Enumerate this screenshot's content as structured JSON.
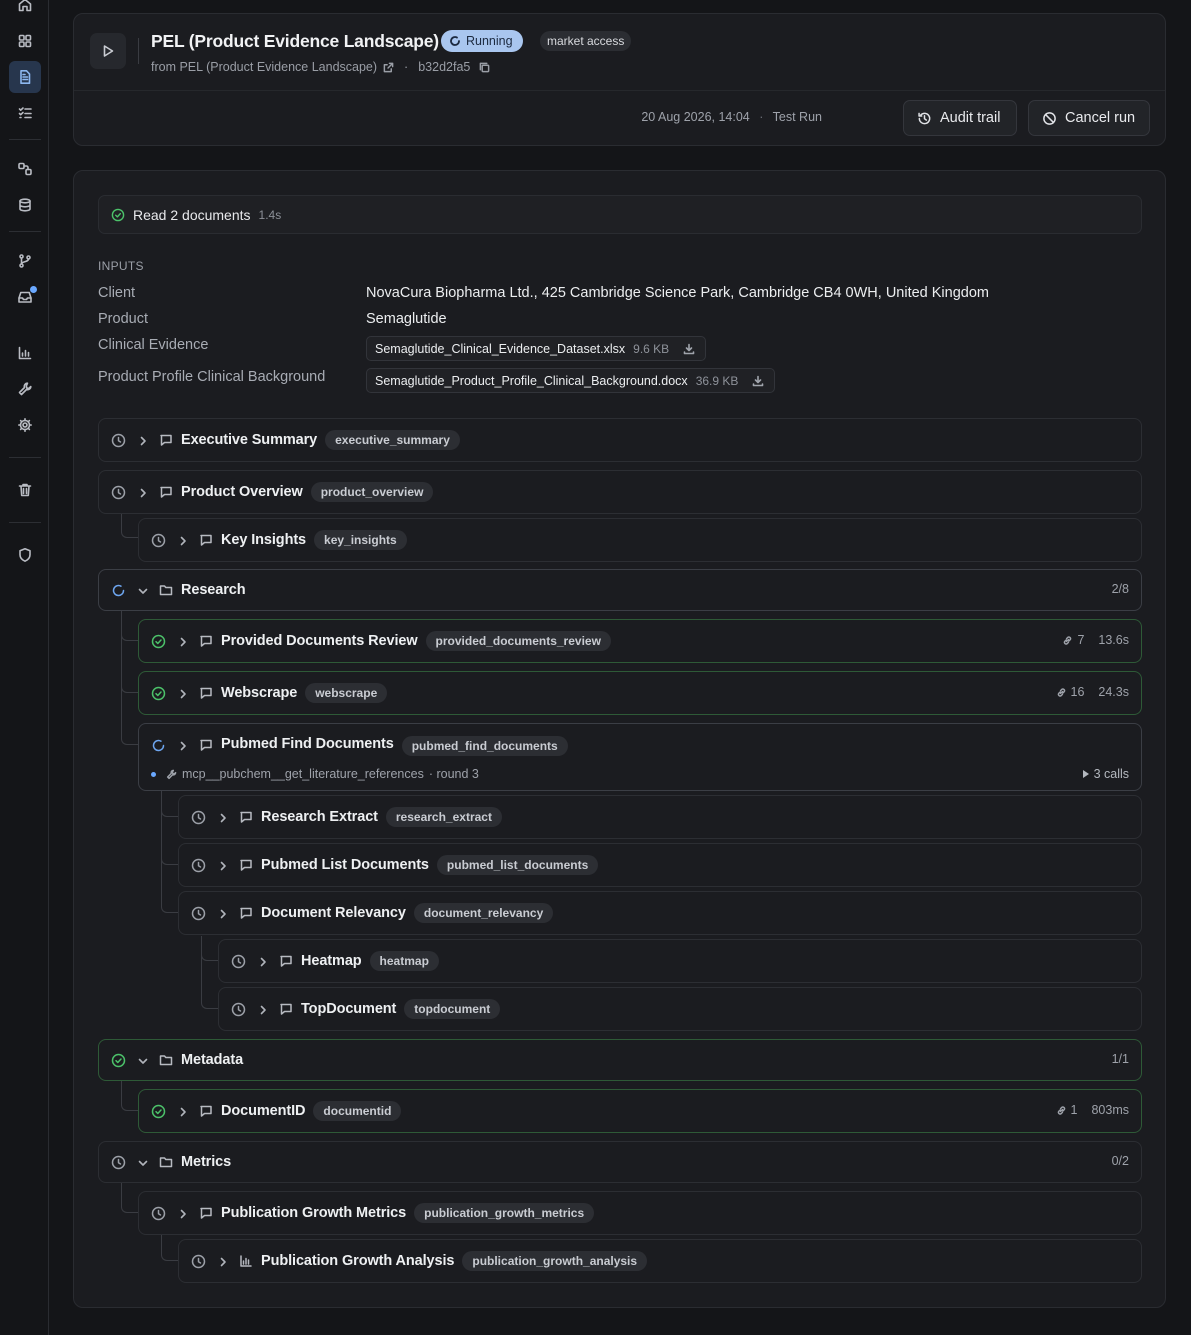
{
  "sidebar": {
    "items": [
      "home-icon",
      "dashboard-icon",
      "runs-icon",
      "tasks-icon",
      "integrations-icon",
      "database-icon",
      "branch-icon",
      "inbox-icon",
      "analytics-icon",
      "tools-icon",
      "settings-icon",
      "trash-icon",
      "shield-icon"
    ],
    "active": "runs-icon"
  },
  "header": {
    "title": "PEL (Product Evidence Landscape)",
    "status": "Running",
    "tag": "market access",
    "from_label": "from PEL (Product Evidence Landscape)",
    "separator": "·",
    "run_id": "b32d2fa5",
    "timestamp": "20 Aug 2026, 14:04",
    "run_type": "Test Run",
    "audit_label": "Audit trail",
    "cancel_label": "Cancel run"
  },
  "read_step": {
    "label": "Read 2 documents",
    "duration": "1.4s"
  },
  "inputs": {
    "title": "INPUTS",
    "client_label": "Client",
    "client_value": "NovaCura Biopharma Ltd., 425 Cambridge Science Park, Cambridge CB4 0WH, United Kingdom",
    "product_label": "Product",
    "product_value": "Semaglutide",
    "clinical_label": "Clinical Evidence",
    "clinical_file": "Semaglutide_Clinical_Evidence_Dataset.xlsx",
    "clinical_size": "9.6 KB",
    "profile_label": "Product Profile Clinical Background",
    "profile_file": "Semaglutide_Product_Profile_Clinical_Background.docx",
    "profile_size": "36.9 KB"
  },
  "tasks": {
    "executive_summary": {
      "name": "Executive Summary",
      "tag": "executive_summary"
    },
    "product_overview": {
      "name": "Product Overview",
      "tag": "product_overview"
    },
    "key_insights": {
      "name": "Key Insights",
      "tag": "key_insights"
    },
    "research": {
      "name": "Research",
      "progress": "2/8"
    },
    "provided_documents_review": {
      "name": "Provided Documents Review",
      "tag": "provided_documents_review",
      "count": "7",
      "duration": "13.6s"
    },
    "webscrape": {
      "name": "Webscrape",
      "tag": "webscrape",
      "count": "16",
      "duration": "24.3s"
    },
    "pubmed_find_documents": {
      "name": "Pubmed Find Documents",
      "tag": "pubmed_find_documents",
      "tool": "mcp__pubchem__get_literature_references",
      "round": "· round 3",
      "calls": "3 calls"
    },
    "research_extract": {
      "name": "Research Extract",
      "tag": "research_extract"
    },
    "pubmed_list_documents": {
      "name": "Pubmed List Documents",
      "tag": "pubmed_list_documents"
    },
    "document_relevancy": {
      "name": "Document Relevancy",
      "tag": "document_relevancy"
    },
    "heatmap": {
      "name": "Heatmap",
      "tag": "heatmap"
    },
    "topdocument": {
      "name": "TopDocument",
      "tag": "topdocument"
    },
    "metadata": {
      "name": "Metadata",
      "progress": "1/1"
    },
    "documentid": {
      "name": "DocumentID",
      "tag": "documentid",
      "count": "1",
      "duration": "803ms"
    },
    "metrics": {
      "name": "Metrics",
      "progress": "0/2"
    },
    "publication_growth_metrics": {
      "name": "Publication Growth Metrics",
      "tag": "publication_growth_metrics"
    },
    "publication_growth_analysis": {
      "name": "Publication Growth Analysis",
      "tag": "publication_growth_analysis"
    }
  },
  "colors": {
    "success": "#4cc26a",
    "running": "#6ea6f0",
    "accent_badge": "#a9c6ef"
  }
}
